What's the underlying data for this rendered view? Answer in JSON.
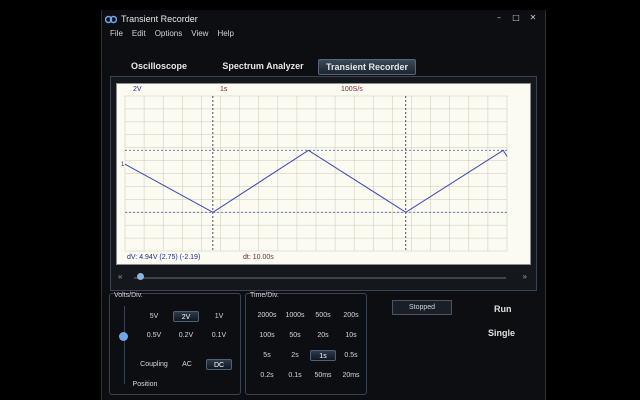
{
  "window": {
    "title": "Transient Recorder"
  },
  "menu": [
    "File",
    "Edit",
    "Options",
    "View",
    "Help"
  ],
  "tabs": [
    {
      "label": "Oscilloscope",
      "active": false
    },
    {
      "label": "Spectrum Analyzer",
      "active": false
    },
    {
      "label": "Transient Recorder",
      "active": true
    }
  ],
  "scope": {
    "top_labels": {
      "volts": "2V",
      "time": "1s",
      "rate": "100S/s"
    },
    "bottom_labels": {
      "dv": "dV: 4.94V  (2.75) (-2.19)",
      "dt": "dt: 10.00s"
    },
    "marker_label": "1",
    "trace_color": "#3a45b8",
    "grid_color": "#c8c8b4"
  },
  "volts_panel": {
    "title": "Volts/Div.",
    "options": [
      "5V",
      "2V",
      "1V",
      "0.5V",
      "0.2V",
      "0.1V"
    ],
    "selected": "2V",
    "coupling_label": "Coupling",
    "coupling_options": [
      "AC",
      "DC"
    ],
    "coupling_selected": "DC",
    "position_label": "Position"
  },
  "time_panel": {
    "title": "Time/Div.",
    "options": [
      "2000s",
      "1000s",
      "500s",
      "200s",
      "100s",
      "50s",
      "20s",
      "10s",
      "5s",
      "2s",
      "1s",
      "0.5s",
      "0.2s",
      "0.1s",
      "50ms",
      "20ms"
    ],
    "selected": "1s"
  },
  "status": "Stopped",
  "actions": {
    "run": "Run",
    "single": "Single"
  },
  "icons": [
    "app-icon",
    "minimize-icon",
    "maximize-icon",
    "close-icon",
    "scroll-left-icon",
    "scroll-right-icon",
    "position-thumb-icon"
  ]
}
